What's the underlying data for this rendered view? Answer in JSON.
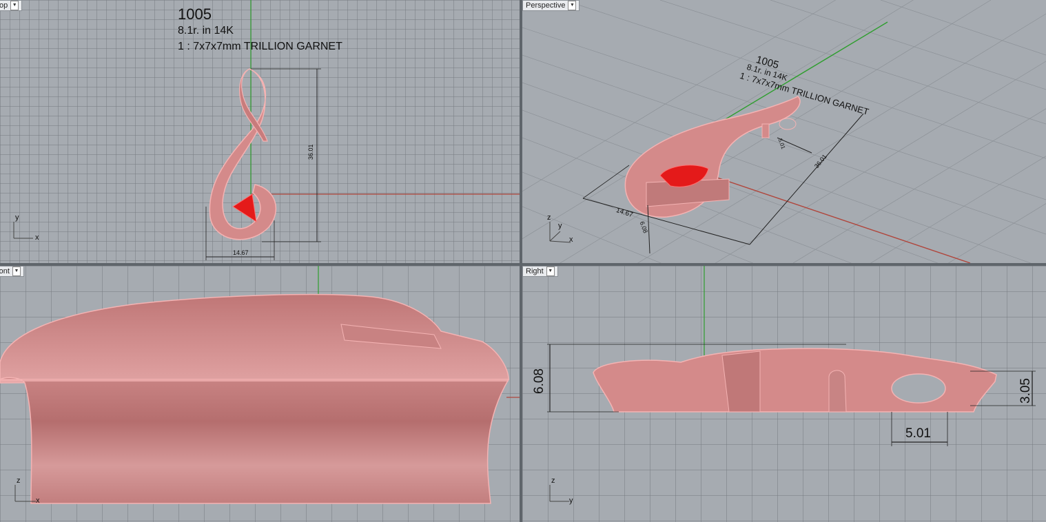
{
  "viewports": {
    "top": {
      "label": "op",
      "axis_a": "y",
      "axis_b": "x"
    },
    "perspective": {
      "label": "Perspective",
      "axis_a": "z",
      "axis_b": "y",
      "axis_c": "x"
    },
    "front": {
      "label": "ront",
      "axis_a": "z",
      "axis_b": "x"
    },
    "right": {
      "label": "Right",
      "axis_a": "z",
      "axis_b": "y"
    }
  },
  "annotation": {
    "model_number": "1005",
    "ring_info": "8.1r.  in 14K",
    "stone_info": "1 : 7x7x7mm TRILLION GARNET",
    "persp_stone_info": "1 : 7x7x7mm TRILLION GARNET"
  },
  "dimensions": {
    "top_height": "36.01",
    "top_width": "14.67",
    "persp_length": "36.01",
    "persp_width": "14.67",
    "persp_depth": "6.08",
    "persp_small": "5.01",
    "right_height": "6.08",
    "right_hole_height": "3.05",
    "right_hole_offset": "5.01"
  },
  "colors": {
    "background": "#a6abb1",
    "grid": "#7c8186",
    "metal": "#d88888",
    "gem": "#e41a1a",
    "x_axis": "#c0392b",
    "y_axis": "#2e9e2e"
  }
}
